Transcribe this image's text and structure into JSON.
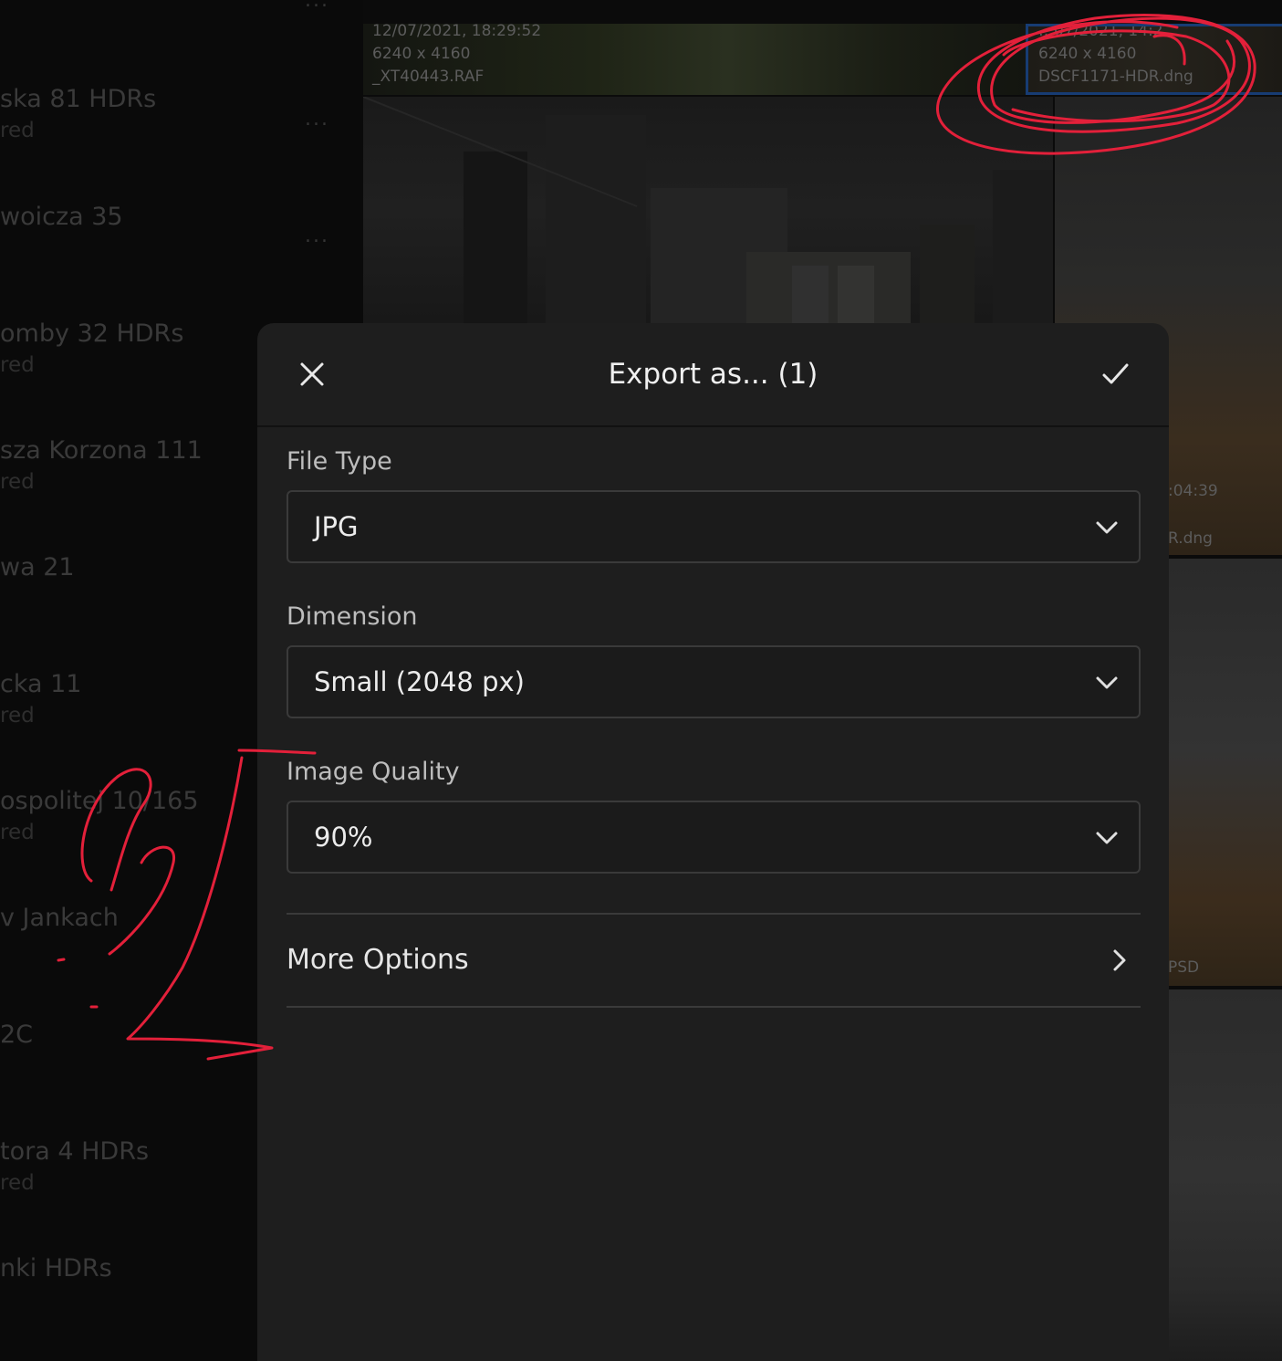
{
  "sidebar": {
    "albums": [
      {
        "name": "ska 81 HDRs",
        "sub": "red"
      },
      {
        "name": "woicza 35",
        "sub": ""
      },
      {
        "name": "omby 32 HDRs",
        "sub": "red"
      },
      {
        "name": "sza Korzona 111",
        "sub": "red"
      },
      {
        "name": "wa 21",
        "sub": ""
      },
      {
        "name": "cka 11",
        "sub": "red"
      },
      {
        "name": "ospolitej 10/165",
        "sub": "red"
      },
      {
        "name": "v Jankach",
        "sub": ""
      },
      {
        "name": "2C",
        "sub": ""
      },
      {
        "name": "tora 4 HDRs",
        "sub": "red"
      },
      {
        "name": "nki HDRs",
        "sub": ""
      }
    ],
    "more_glyph": "..."
  },
  "grid": {
    "tile1": {
      "date": "12/07/2021, 18:29:52",
      "dimensions": "6240 x 4160",
      "filename": "_XT40443.RAF"
    },
    "tile2": {
      "date": "…07/2021, 14:2…",
      "dimensions": "6240 x 4160",
      "filename": "DSCF1171-HDR.dng"
    },
    "partial_time": ":04:39",
    "partial_file": "R.dng",
    "partial_psd": "PSD"
  },
  "dialog": {
    "title": "Export as... (1)",
    "close_icon": "close-icon",
    "confirm_icon": "checkmark-icon",
    "file_type": {
      "label": "File Type",
      "value": "JPG"
    },
    "dimension": {
      "label": "Dimension",
      "value": "Small (2048 px)"
    },
    "image_quality": {
      "label": "Image Quality",
      "value": "90%"
    },
    "more_options": {
      "label": "More Options"
    }
  },
  "colors": {
    "dialog_bg": "#1e1e1e",
    "annotation_red": "#e3203a",
    "selection_blue": "#173c73"
  }
}
